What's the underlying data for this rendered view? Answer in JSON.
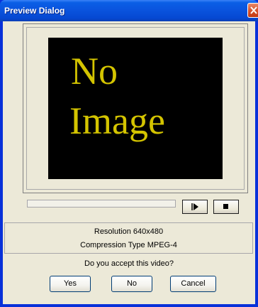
{
  "window": {
    "title": "Preview Dialog"
  },
  "video": {
    "placeholder_line1": "No",
    "placeholder_line2": "Image"
  },
  "info": {
    "resolution": "Resolution 640x480",
    "compression": "Compression Type MPEG-4"
  },
  "question": "Do you accept this video?",
  "buttons": {
    "yes": "Yes",
    "no": "No",
    "cancel": "Cancel"
  },
  "icons": {
    "close": "close-icon",
    "play": "play-icon",
    "stop": "stop-icon"
  },
  "colors": {
    "titlebar": "#0a54de",
    "placeholder_text": "#d4c400",
    "dialog_bg": "#ece9d8",
    "close_button": "#d9542c"
  }
}
